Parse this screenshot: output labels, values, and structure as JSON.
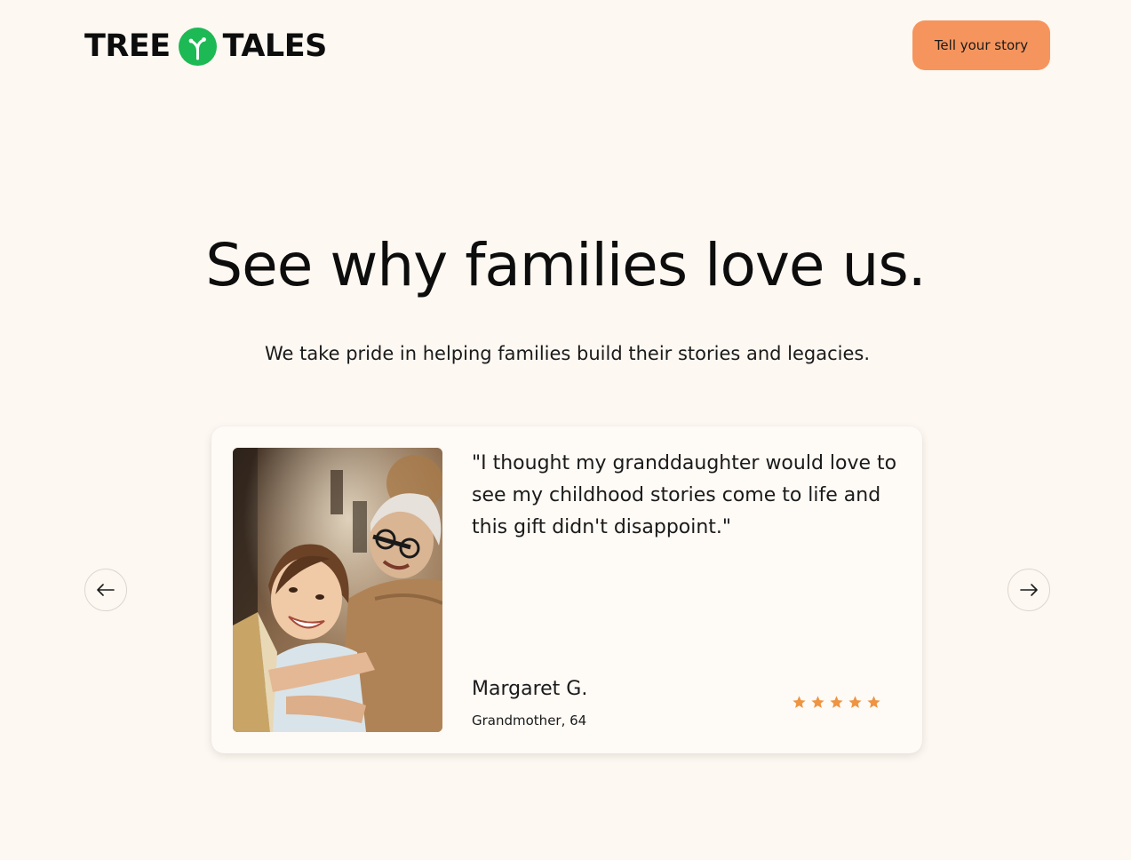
{
  "header": {
    "logo_left": "TREE",
    "logo_right": "TALES",
    "cta_label": "Tell your story"
  },
  "hero": {
    "title": "See why families love us.",
    "subtitle": "We take pride in helping families build their stories and legacies."
  },
  "testimonial": {
    "quote": "\"I thought my granddaughter would love to see my childhood stories come to life and this gift didn't disappoint.\"",
    "author_name": "Margaret G.",
    "author_role": "Grandmother, 64",
    "rating": 5,
    "rating_max": 5
  },
  "colors": {
    "background": "#fef8f2",
    "accent": "#f5955d",
    "logo_green": "#1db954",
    "star": "#ee9442"
  },
  "icons": {
    "logo_mark": "tree-sprout-icon",
    "prev": "arrow-left-icon",
    "next": "arrow-right-icon",
    "rating": "star-icon"
  }
}
